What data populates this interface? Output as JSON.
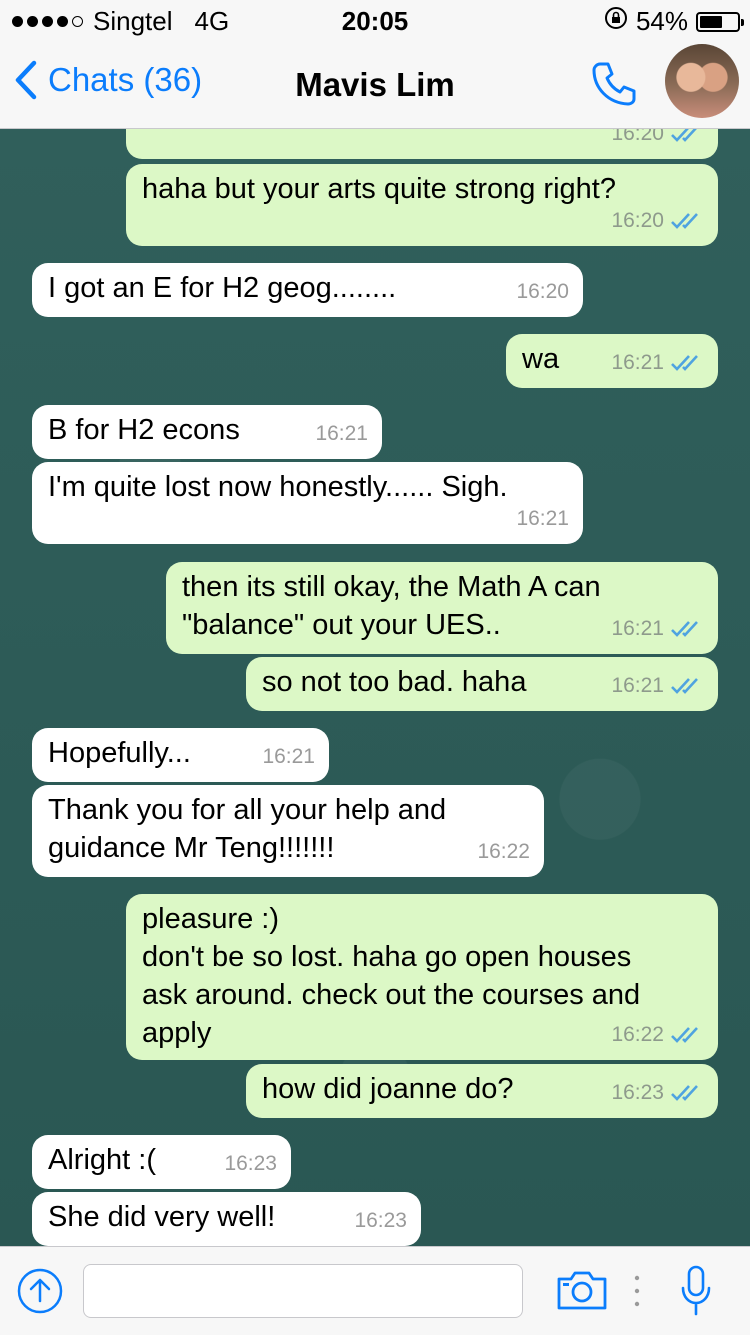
{
  "status": {
    "carrier": "Singtel",
    "network": "4G",
    "time": "20:05",
    "battery": "54%",
    "battery_fraction": 0.54
  },
  "nav": {
    "back_label": "Chats (36)",
    "title": "Mavis Lim"
  },
  "messages": [
    {
      "dir": "out",
      "text": "",
      "time": "16:20"
    },
    {
      "dir": "out",
      "text": "haha but your arts quite strong right?",
      "time": "16:20"
    },
    {
      "dir": "in",
      "text": "I got an E for H2 geog........",
      "time": "16:20"
    },
    {
      "dir": "out",
      "text": "wa",
      "time": "16:21"
    },
    {
      "dir": "in",
      "text": "B for H2 econs",
      "time": "16:21"
    },
    {
      "dir": "in",
      "text": "I'm quite lost now honestly...... Sigh.",
      "time": "16:21"
    },
    {
      "dir": "out",
      "text": "then its still okay, the Math A can\n\"balance\" out your UES..",
      "time": "16:21"
    },
    {
      "dir": "out",
      "text": "so not too bad. haha",
      "time": "16:21"
    },
    {
      "dir": "in",
      "text": "Hopefully...",
      "time": "16:21"
    },
    {
      "dir": "in",
      "text": "Thank you for all your help and\nguidance Mr Teng!!!!!!!",
      "time": "16:22"
    },
    {
      "dir": "out",
      "text": "pleasure :)\ndon't be so lost. haha go open houses\nask around. check out the courses and\napply",
      "time": "16:22"
    },
    {
      "dir": "out",
      "text": "how did joanne do?",
      "time": "16:23"
    },
    {
      "dir": "in",
      "text": "Alright :(",
      "time": "16:23"
    },
    {
      "dir": "in",
      "text": "She did very well!",
      "time": "16:23"
    }
  ],
  "input": {
    "placeholder": ""
  },
  "colors": {
    "accent": "#0b7dfc",
    "outgoing": "#dcf8c6",
    "incoming": "#ffffff",
    "tick": "#4fa3e0"
  }
}
